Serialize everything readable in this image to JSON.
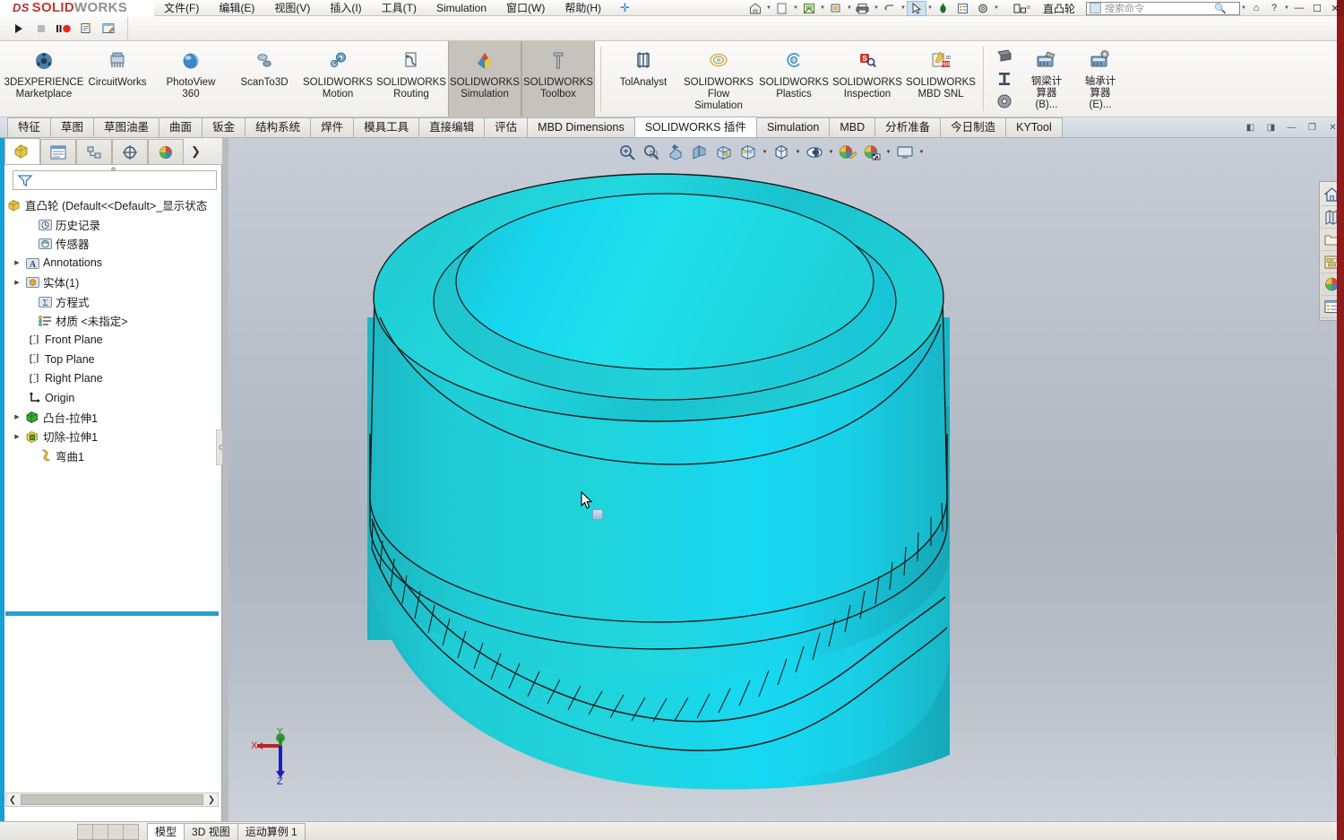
{
  "app": {
    "brand_ds": "DS",
    "brand_solid": "SOLID",
    "brand_works": "WORKS",
    "document_title": "直凸轮",
    "accent_color": "#1a9fd4",
    "model_color": "#1fd6dc"
  },
  "menubar": {
    "items": [
      {
        "label": "文件(F)"
      },
      {
        "label": "编辑(E)"
      },
      {
        "label": "视图(V)"
      },
      {
        "label": "插入(I)"
      },
      {
        "label": "工具(T)"
      },
      {
        "label": "Simulation"
      },
      {
        "label": "窗口(W)"
      },
      {
        "label": "帮助(H)"
      }
    ],
    "pin": "✛"
  },
  "quickaccess": {
    "icons": [
      {
        "name": "new-document-icon",
        "glyph": "🏠"
      },
      {
        "name": "open-document-icon",
        "glyph": "▢"
      },
      {
        "name": "save-icon",
        "glyph": "▣"
      },
      {
        "name": "print-icon",
        "glyph": "🖶"
      },
      {
        "name": "undo-icon",
        "glyph": "↶"
      },
      {
        "name": "select-icon",
        "glyph": "➹"
      },
      {
        "name": "rebuild-icon",
        "glyph": "⬤"
      },
      {
        "name": "file-properties-icon",
        "glyph": "▤"
      },
      {
        "name": "options-icon",
        "glyph": "⚙"
      },
      {
        "name": "tab-display-icon",
        "glyph": "▤"
      }
    ]
  },
  "search": {
    "placeholder": "搜索命令",
    "value": ""
  },
  "window_controls": {
    "help_balloon": "⌂",
    "help": "?",
    "minimize": "—",
    "maximize": "☐",
    "close": "✕"
  },
  "macrobar": {
    "buttons": [
      {
        "name": "run-macro-button",
        "glyph": "▶"
      },
      {
        "name": "stop-macro-button",
        "glyph": "■"
      },
      {
        "name": "record-macro-button",
        "glyph": "❙❙●"
      },
      {
        "name": "new-macro-button",
        "glyph": "🗎"
      },
      {
        "name": "edit-macro-button",
        "glyph": "🗏"
      }
    ]
  },
  "ribbon": {
    "buttons": [
      {
        "label": "3DEXPERIENCE\nMarketplace",
        "line1": "3DEXPERIENCE",
        "line2": "Marketplace",
        "icon": "marketplace-icon",
        "active": false
      },
      {
        "label": "CircuitWorks",
        "line1": "CircuitWorks",
        "line2": "",
        "icon": "circuitworks-icon",
        "active": false
      },
      {
        "label": "PhotoView 360",
        "line1": "PhotoView",
        "line2": "360",
        "icon": "photoview360-icon",
        "active": false
      },
      {
        "label": "ScanTo3D",
        "line1": "ScanTo3D",
        "line2": "",
        "icon": "scanto3d-icon",
        "active": false
      },
      {
        "label": "SOLIDWORKS Motion",
        "line1": "SOLIDWORKS",
        "line2": "Motion",
        "icon": "solidworks-motion-icon",
        "active": false
      },
      {
        "label": "SOLIDWORKS Routing",
        "line1": "SOLIDWORKS",
        "line2": "Routing",
        "icon": "solidworks-routing-icon",
        "active": false
      },
      {
        "label": "SOLIDWORKS Simulation",
        "line1": "SOLIDWORKS",
        "line2": "Simulation",
        "icon": "solidworks-simulation-icon",
        "active": true
      },
      {
        "label": "SOLIDWORKS Toolbox",
        "line1": "SOLIDWORKS",
        "line2": "Toolbox",
        "icon": "solidworks-toolbox-icon",
        "active": true
      },
      {
        "label": "TolAnalyst",
        "line1": "TolAnalyst",
        "line2": "",
        "icon": "tolanalyst-icon",
        "active": false
      },
      {
        "label": "SOLIDWORKS Flow Simulation",
        "line1": "SOLIDWORKS",
        "line2": "Flow",
        "line3": "Simulation",
        "icon": "flow-simulation-icon",
        "active": false
      },
      {
        "label": "SOLIDWORKS Plastics",
        "line1": "SOLIDWORKS",
        "line2": "Plastics",
        "icon": "solidworks-plastics-icon",
        "active": false
      },
      {
        "label": "SOLIDWORKS Inspection",
        "line1": "SOLIDWORKS",
        "line2": "Inspection",
        "icon": "solidworks-inspection-icon",
        "active": false
      },
      {
        "label": "SOLIDWORKS MBD SNL",
        "line1": "SOLIDWORKS",
        "line2": "MBD SNL",
        "icon": "solidworks-mbd-snl-icon",
        "active": false
      }
    ],
    "calculators": [
      {
        "line1": "钢梁计",
        "line2": "算器",
        "line3": "(B)...",
        "icon": "beam-calculator-icon"
      },
      {
        "line1": "轴承计",
        "line2": "算器",
        "line3": "(E)...",
        "icon": "bearing-calculator-icon"
      }
    ],
    "small_icons": [
      {
        "name": "structural-member-icon",
        "glyph": "◣"
      },
      {
        "name": "moment-of-inertia-icon",
        "glyph": "H"
      },
      {
        "name": "cam-icon",
        "glyph": "◎"
      }
    ]
  },
  "command_tabs": {
    "tabs": [
      {
        "label": "特征",
        "active": false
      },
      {
        "label": "草图",
        "active": false
      },
      {
        "label": "草图油墨",
        "active": false
      },
      {
        "label": "曲面",
        "active": false
      },
      {
        "label": "钣金",
        "active": false
      },
      {
        "label": "结构系统",
        "active": false
      },
      {
        "label": "焊件",
        "active": false
      },
      {
        "label": "模具工具",
        "active": false
      },
      {
        "label": "直接编辑",
        "active": false
      },
      {
        "label": "评估",
        "active": false
      },
      {
        "label": "MBD Dimensions",
        "active": false
      },
      {
        "label": "SOLIDWORKS 插件",
        "active": true
      },
      {
        "label": "Simulation",
        "active": false
      },
      {
        "label": "MBD",
        "active": false
      },
      {
        "label": "分析准备",
        "active": false
      },
      {
        "label": "今日制造",
        "active": false
      },
      {
        "label": "KYTool",
        "active": false
      }
    ],
    "doc_controls": [
      {
        "name": "previous-document-button",
        "glyph": "◧"
      },
      {
        "name": "next-document-button",
        "glyph": "◨"
      },
      {
        "name": "minimize-document-button",
        "glyph": "—"
      },
      {
        "name": "restore-document-button",
        "glyph": "❐"
      },
      {
        "name": "close-document-button",
        "glyph": "✕"
      }
    ]
  },
  "feature_manager": {
    "tabs": [
      {
        "name": "feature-manager-tab",
        "active": true
      },
      {
        "name": "property-manager-tab",
        "active": false
      },
      {
        "name": "configuration-manager-tab",
        "active": false
      },
      {
        "name": "dimxpert-manager-tab",
        "active": false
      },
      {
        "name": "display-manager-tab",
        "active": false
      }
    ],
    "more_glyph": "❯",
    "filter_placeholder": "",
    "root": {
      "label": "直凸轮  (Default<<Default>_显示状态",
      "icon": "part-icon"
    },
    "tree": [
      {
        "label": "历史记录",
        "icon": "history-icon",
        "expandable": false,
        "indent": 1
      },
      {
        "label": "传感器",
        "icon": "sensors-icon",
        "expandable": false,
        "indent": 1
      },
      {
        "label": "Annotations",
        "icon": "annotations-icon",
        "expandable": true,
        "indent": 1
      },
      {
        "label": "实体(1)",
        "icon": "solid-bodies-icon",
        "expandable": true,
        "indent": 1
      },
      {
        "label": "方程式",
        "icon": "equations-icon",
        "expandable": false,
        "indent": 1
      },
      {
        "label": "材质 <未指定>",
        "icon": "material-icon",
        "expandable": false,
        "indent": 1
      },
      {
        "label": "Front Plane",
        "icon": "plane-icon",
        "expandable": false,
        "indent": 1
      },
      {
        "label": "Top Plane",
        "icon": "plane-icon",
        "expandable": false,
        "indent": 1
      },
      {
        "label": "Right Plane",
        "icon": "plane-icon",
        "expandable": false,
        "indent": 1
      },
      {
        "label": "Origin",
        "icon": "origin-icon",
        "expandable": false,
        "indent": 1
      },
      {
        "label": "凸台-拉伸1",
        "icon": "boss-extrude-icon",
        "expandable": true,
        "indent": 1
      },
      {
        "label": "切除-拉伸1",
        "icon": "cut-extrude-icon",
        "expandable": true,
        "indent": 1
      },
      {
        "label": "弯曲1",
        "icon": "flex-icon",
        "expandable": false,
        "indent": 1
      }
    ],
    "scroll": {
      "left_arrow": "❮",
      "right_arrow": "❯"
    }
  },
  "view_toolbar": {
    "buttons": [
      {
        "name": "zoom-to-fit-icon",
        "has_caret": false
      },
      {
        "name": "zoom-to-area-icon",
        "has_caret": false
      },
      {
        "name": "previous-view-icon",
        "has_caret": false
      },
      {
        "name": "section-view-icon",
        "has_caret": false
      },
      {
        "name": "view-orientation-icon",
        "has_caret": true
      },
      {
        "name": "display-style-icon",
        "has_caret": true
      },
      {
        "name": "hide-show-items-icon",
        "has_caret": true
      },
      {
        "name": "edit-appearance-icon",
        "has_caret": false
      },
      {
        "name": "apply-scene-icon",
        "has_caret": true
      },
      {
        "name": "view-settings-icon",
        "has_caret": true
      }
    ]
  },
  "task_pane": {
    "icons": [
      {
        "name": "solidworks-resources-icon",
        "glyph": "⌂"
      },
      {
        "name": "design-library-icon",
        "glyph": "◫"
      },
      {
        "name": "file-explorer-icon",
        "glyph": "🗀"
      },
      {
        "name": "view-palette-icon",
        "glyph": "▤"
      },
      {
        "name": "appearances-scenes-icon",
        "glyph": "◕"
      },
      {
        "name": "custom-properties-icon",
        "glyph": "☰"
      }
    ]
  },
  "triad": {
    "x_label": "X",
    "y_label": "Y",
    "z_label": "Z",
    "x_color": "#c02020",
    "y_color": "#1e8c1e",
    "z_color": "#2020b0"
  },
  "bottom_bar": {
    "tabs": [
      {
        "label": "模型",
        "active": true
      },
      {
        "label": "3D 视图",
        "active": false
      },
      {
        "label": "运动算例 1",
        "active": false
      }
    ],
    "left_icons": [
      {
        "name": "bottom-icon-1"
      },
      {
        "name": "bottom-icon-2"
      },
      {
        "name": "bottom-icon-3"
      },
      {
        "name": "bottom-icon-4"
      }
    ]
  }
}
